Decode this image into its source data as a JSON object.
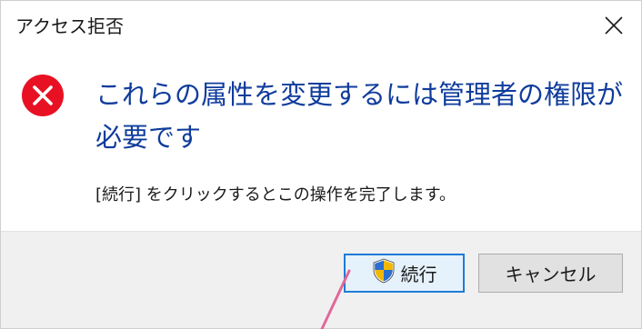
{
  "window": {
    "title": "アクセス拒否"
  },
  "message": {
    "heading": "これらの属性を変更するには管理者の権限が必要です",
    "instruction": "[続行] をクリックするとこの操作を完了します。"
  },
  "buttons": {
    "continue_label": "続行",
    "cancel_label": "キャンセル"
  },
  "colors": {
    "heading": "#0f3c9c",
    "error": "#e81123",
    "focus": "#1e7bd6",
    "annotation": "#e2679a"
  },
  "icons": {
    "error": "error-x-circle",
    "shield": "uac-shield",
    "close": "close-x"
  }
}
